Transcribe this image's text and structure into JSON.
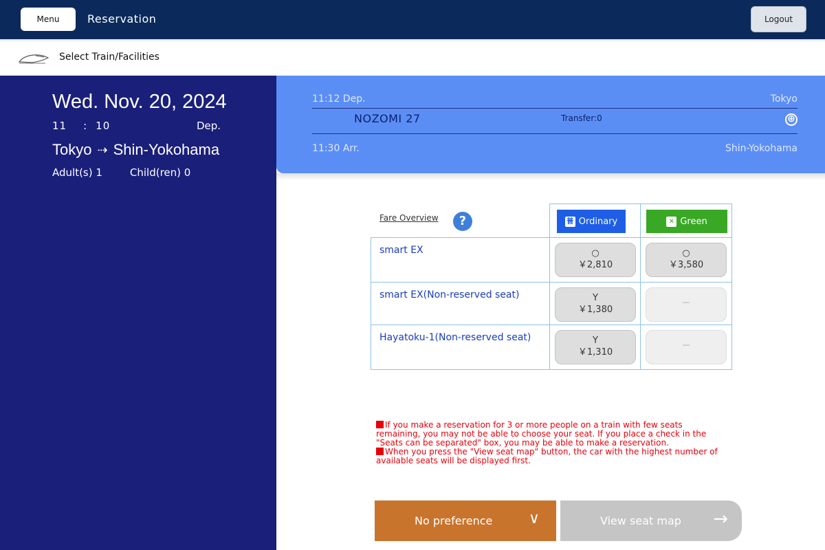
{
  "header": {
    "menu_label": "Menu",
    "title": "Reservation",
    "logout_label": "Logout"
  },
  "breadcrumb": {
    "icon": "train-icon",
    "label": "Select Train/Facilities"
  },
  "summary": {
    "date": "Wed. Nov. 20, 2024",
    "hour": "11",
    "colon": ":",
    "minute": "10",
    "dep_label": "Dep.",
    "from": "Tokyo",
    "route_arrow": "⇢",
    "to": "Shin-Yokohama",
    "adults": "Adult(s) 1",
    "children": "Child(ren) 0"
  },
  "train": {
    "dep_time": "11:12 Dep.",
    "dep_station": "Tokyo",
    "name": "NOZOMI 27",
    "transfer": "Transfer:0",
    "expand_icon": "⊕",
    "arr_time": "11:30 Arr.",
    "arr_station": "Shin-Yokohama"
  },
  "fares": {
    "overview_link": "Fare Overview",
    "help_icon": "?",
    "ordinary_icon": "普",
    "ordinary_label": "Ordinary",
    "green_icon": "✕",
    "green_label": "Green",
    "rows": [
      {
        "name": "smart EX",
        "ordinary_mark": "○",
        "ordinary_price": "￥2,810",
        "green_mark": "○",
        "green_price": "￥3,580"
      },
      {
        "name": "smart EX(Non-reserved seat)",
        "ordinary_mark": "Y",
        "ordinary_price": "￥1,380",
        "green_dash": "－"
      },
      {
        "name": "Hayatoku-1(Non-reserved seat)",
        "ordinary_mark": "Y",
        "ordinary_price": "￥1,310",
        "green_dash": "－"
      }
    ]
  },
  "notice": {
    "line1": "If you make a reservation for 3 or more people on a train with few seats remaining, you may not be able to choose your seat. If you place a check in the \"Seats can be separated\" box, you may be able to make a reservation.",
    "line2": "When you press the \"View seat map\" button, the car with the highest number of available seats will be displayed first."
  },
  "actions": {
    "preference_label": "No preference",
    "preference_chevron": "∨",
    "seat_map_label": "View seat map",
    "seat_map_arrow": "→"
  },
  "colors": {
    "header_bg": "#0b2a5b",
    "left_panel_bg": "#1a1f7a",
    "train_panel_bg": "#5b8ef5",
    "ordinary": "#1e5ee6",
    "green": "#39a825",
    "notice": "#e8000b",
    "preference_btn": "#c8742c",
    "seat_map_btn_disabled": "#c5c5c5"
  }
}
